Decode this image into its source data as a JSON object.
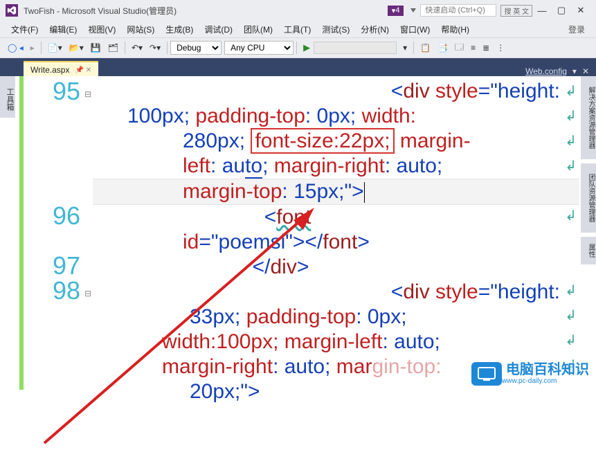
{
  "window": {
    "title": "TwoFish - Microsoft Visual Studio(管理员)",
    "notification_count": "4",
    "quicklaunch_placeholder": "快速启动 (Ctrl+Q)",
    "ime_label": "搜 英 文"
  },
  "menu": {
    "file": "文件(F)",
    "edit": "编辑(E)",
    "view": "视图(V)",
    "website": "网站(S)",
    "build": "生成(B)",
    "debug": "调试(D)",
    "team": "团队(M)",
    "tools": "工具(T)",
    "test": "测试(S)",
    "analyze": "分析(N)",
    "window": "窗口(W)",
    "help": "帮助(H)",
    "login": "登录"
  },
  "toolbar": {
    "config_value": "Debug",
    "platform_value": "Any CPU"
  },
  "tabs": {
    "active": "Write.aspx",
    "right_link": "Web.config"
  },
  "sidetools": {
    "left": "工具箱",
    "right1": "解决方案资源管理器",
    "right2": "团队资源管理器",
    "right3": "属性"
  },
  "code": {
    "lines": {
      "l95": "95",
      "l96": "96",
      "l97": "97",
      "l98": "98"
    },
    "seg": {
      "div_open": "<div ",
      "style_attr": "style",
      "eq": "=",
      "q": "\"",
      "height": "height:",
      "h100": "100px; ",
      "padtop": "padding-top",
      "zero": ": 0px; ",
      "width": "width:",
      "w280": "280px; ",
      "fontsize": "font-size:22px;",
      "marginl": " margin-left",
      "au1": ": au",
      "to1": "to",
      "semito": "; ",
      "marginr": "margin-right",
      "auto2": ": auto;",
      "margint": "margin-top",
      "mt15": ": 15px;",
      "gt": ">",
      "font_open": "<font",
      "id_attr": "id",
      "poemsi": "\"poemsi\"",
      "font_close_self": "></font>",
      "div_close": "</div>",
      "h33": "33px; ",
      "w100": "width:100px; ",
      "marginl2": "margin-left",
      "auto3": ": auto;",
      "marginr2": "margin-right",
      "auto4": ": auto; ",
      "margint2": "mar",
      "gin_top": "gin-top:",
      "px20": "20px;",
      "close_gt": ">"
    }
  },
  "watermark": {
    "title": "电脑百科知识",
    "url": "www.pc-daily.com"
  }
}
